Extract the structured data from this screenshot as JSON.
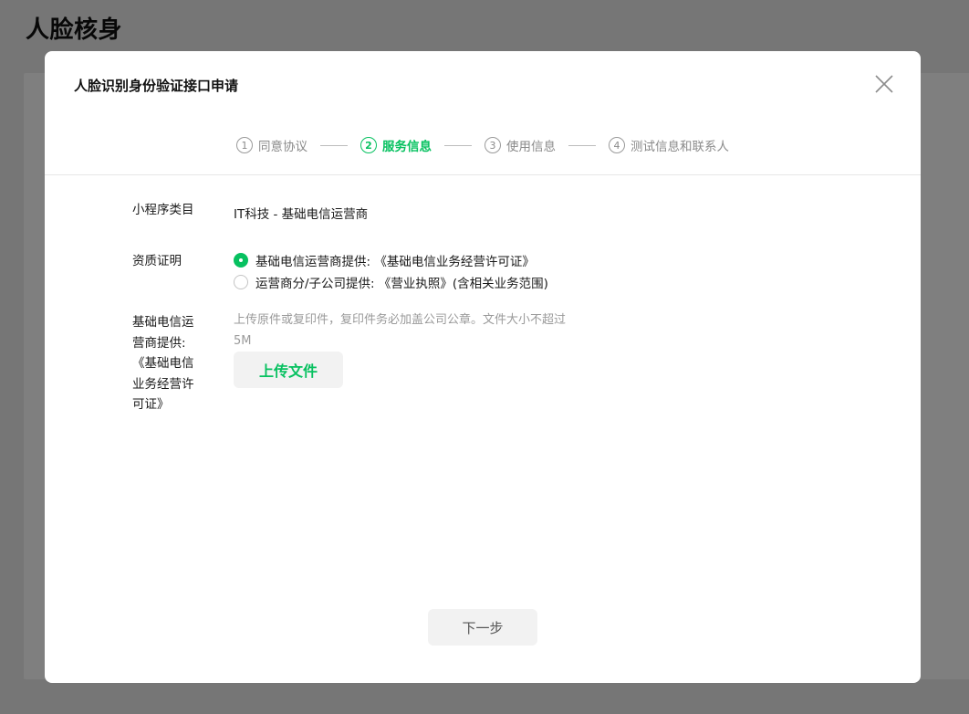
{
  "background": {
    "page_title": "人脸核身"
  },
  "dialog": {
    "title": "人脸识别身份验证接口申请",
    "close_icon": "close-icon"
  },
  "steps": [
    {
      "num": "1",
      "label": "同意协议",
      "active": false
    },
    {
      "num": "2",
      "label": "服务信息",
      "active": true
    },
    {
      "num": "3",
      "label": "使用信息",
      "active": false
    },
    {
      "num": "4",
      "label": "测试信息和联系人",
      "active": false
    }
  ],
  "form": {
    "category": {
      "label": "小程序类目",
      "value": "IT科技 - 基础电信运营商"
    },
    "qualification": {
      "label": "资质证明",
      "options": [
        {
          "label": "基础电信运营商提供: 《基础电信业务经营许可证》",
          "checked": true
        },
        {
          "label": "运营商分/子公司提供: 《营业执照》(含相关业务范围)",
          "checked": false
        }
      ]
    },
    "license": {
      "label_lines": [
        "基础电信运",
        "营商提供:",
        "《基础电信",
        "业务经营许",
        "可证》"
      ],
      "hint": "上传原件或复印件，复印件务必加盖公司公章。文件大小不超过5M",
      "upload_label": "上传文件"
    }
  },
  "footer": {
    "next_label": "下一步"
  },
  "colors": {
    "accent": "#07c160",
    "overlay": "rgba(0,0,0,0.5)"
  }
}
